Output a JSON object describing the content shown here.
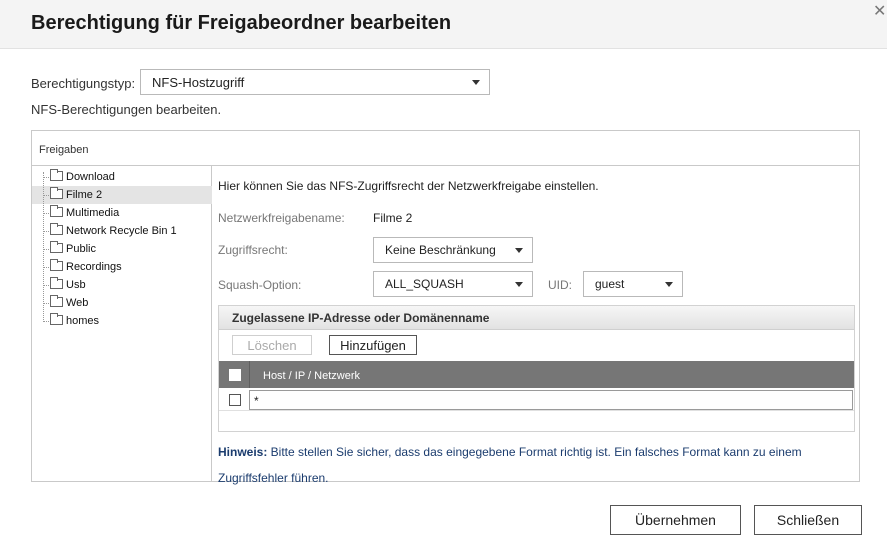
{
  "dialog": {
    "title": "Berechtigung für Freigabeordner bearbeiten"
  },
  "permission_type": {
    "label": "Berechtigungstyp:",
    "value": "NFS-Hostzugriff"
  },
  "subtitle": "NFS-Berechtigungen bearbeiten.",
  "shares_panel": {
    "header": "Freigaben",
    "items": [
      {
        "label": "Download",
        "selected": false
      },
      {
        "label": "Filme 2",
        "selected": true
      },
      {
        "label": "Multimedia",
        "selected": false
      },
      {
        "label": "Network Recycle Bin 1",
        "selected": false
      },
      {
        "label": "Public",
        "selected": false
      },
      {
        "label": "Recordings",
        "selected": false
      },
      {
        "label": "Usb",
        "selected": false
      },
      {
        "label": "Web",
        "selected": false
      },
      {
        "label": "homes",
        "selected": false
      }
    ]
  },
  "detail": {
    "intro": "Hier können Sie das NFS-Zugriffsrecht der Netzwerkfreigabe einstellen.",
    "share_name_label": "Netzwerkfreigabename:",
    "share_name_value": "Filme 2",
    "access_label": "Zugriffsrecht:",
    "access_value": "Keine Beschränkung",
    "squash_label": "Squash-Option:",
    "squash_value": "ALL_SQUASH",
    "uid_label": "UID:",
    "uid_value": "guest"
  },
  "ip_section": {
    "title": "Zugelassene IP-Adresse oder Domänenname",
    "delete_label": "Löschen",
    "add_label": "Hinzufügen",
    "column_header": "Host / IP / Netzwerk",
    "rows": [
      {
        "value": "*",
        "checked": false
      }
    ]
  },
  "hint": {
    "prefix": "Hinweis:",
    "line1": " Bitte stellen Sie sicher, dass das eingegebene Format richtig ist. Ein falsches Format kann zu einem",
    "line2": "Zugriffsfehler führen."
  },
  "footer": {
    "apply_label": "Übernehmen",
    "close_label": "Schließen"
  },
  "colors": {
    "table_header_bg": "#767676",
    "hint_text": "#1b3c6e"
  },
  "icons": {
    "close": "close-icon",
    "folder": "folder-icon",
    "dropdown": "chevron-down-icon"
  }
}
